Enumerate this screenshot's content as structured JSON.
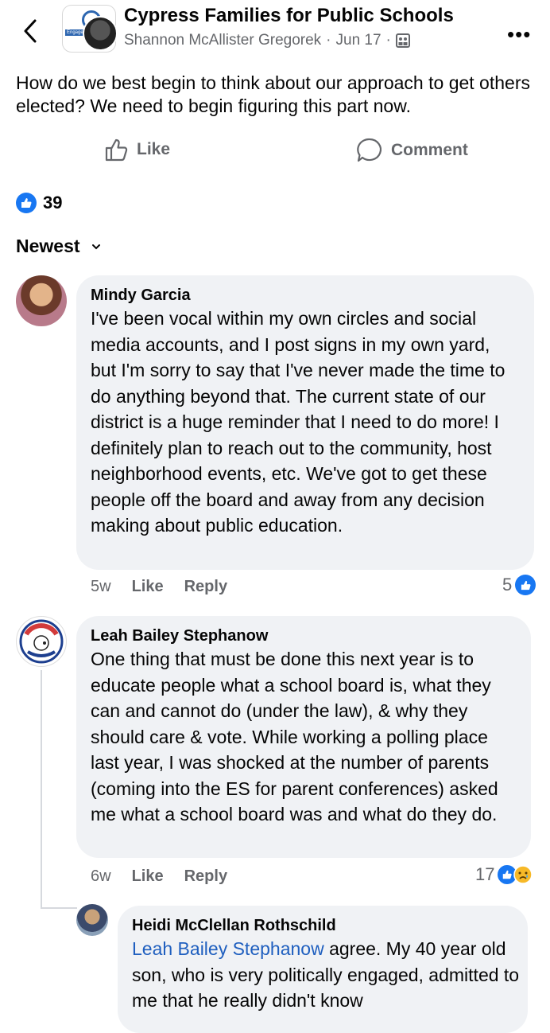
{
  "header": {
    "group_name": "Cypress Families for Public Schools",
    "author": "Shannon McAllister Gregorek",
    "separator": "·",
    "date": "Jun 17",
    "separator2": "·",
    "group_avatar_text": "Engage"
  },
  "post": {
    "text": "How do we best begin to think about our approach to get others elected?  We need to begin figuring this part now.",
    "like_label": "Like",
    "comment_label": "Comment",
    "reaction_count": "39"
  },
  "sort": {
    "label": "Newest"
  },
  "comments": [
    {
      "name": "Mindy Garcia",
      "text": "I've been vocal within my own circles and social media accounts, and I post signs in my own yard, but I'm sorry to say that I've never made the time to do anything beyond that. The current state of our district is a huge reminder that I need to do more! I definitely plan to reach out to the community, host neighborhood events, etc. We've got to get these people off the board and away from any decision making about public education.",
      "time": "5w",
      "like": "Like",
      "reply": "Reply",
      "reactions": "5"
    },
    {
      "name": "Leah Bailey Stephanow",
      "text": "One thing that must be done this next year is to educate people what a school board is, what they can and cannot do (under the law), & why they should care & vote. While working a polling place last year, I was shocked at the number of parents (coming into the ES for parent conferences) asked me what a school board was and what do they do.",
      "time": "6w",
      "like": "Like",
      "reply": "Reply",
      "reactions": "17"
    }
  ],
  "reply": {
    "name": "Heidi McClellan Rothschild",
    "tag": "Leah Bailey Stephanow",
    "text": " agree. My 40 year old son, who is very politically engaged, admitted to me that he really didn't know"
  },
  "colors": {
    "accent": "#1877f2",
    "bubble": "#f0f2f5",
    "secondary_text": "#65676b",
    "tag": "#1f5fbf"
  }
}
